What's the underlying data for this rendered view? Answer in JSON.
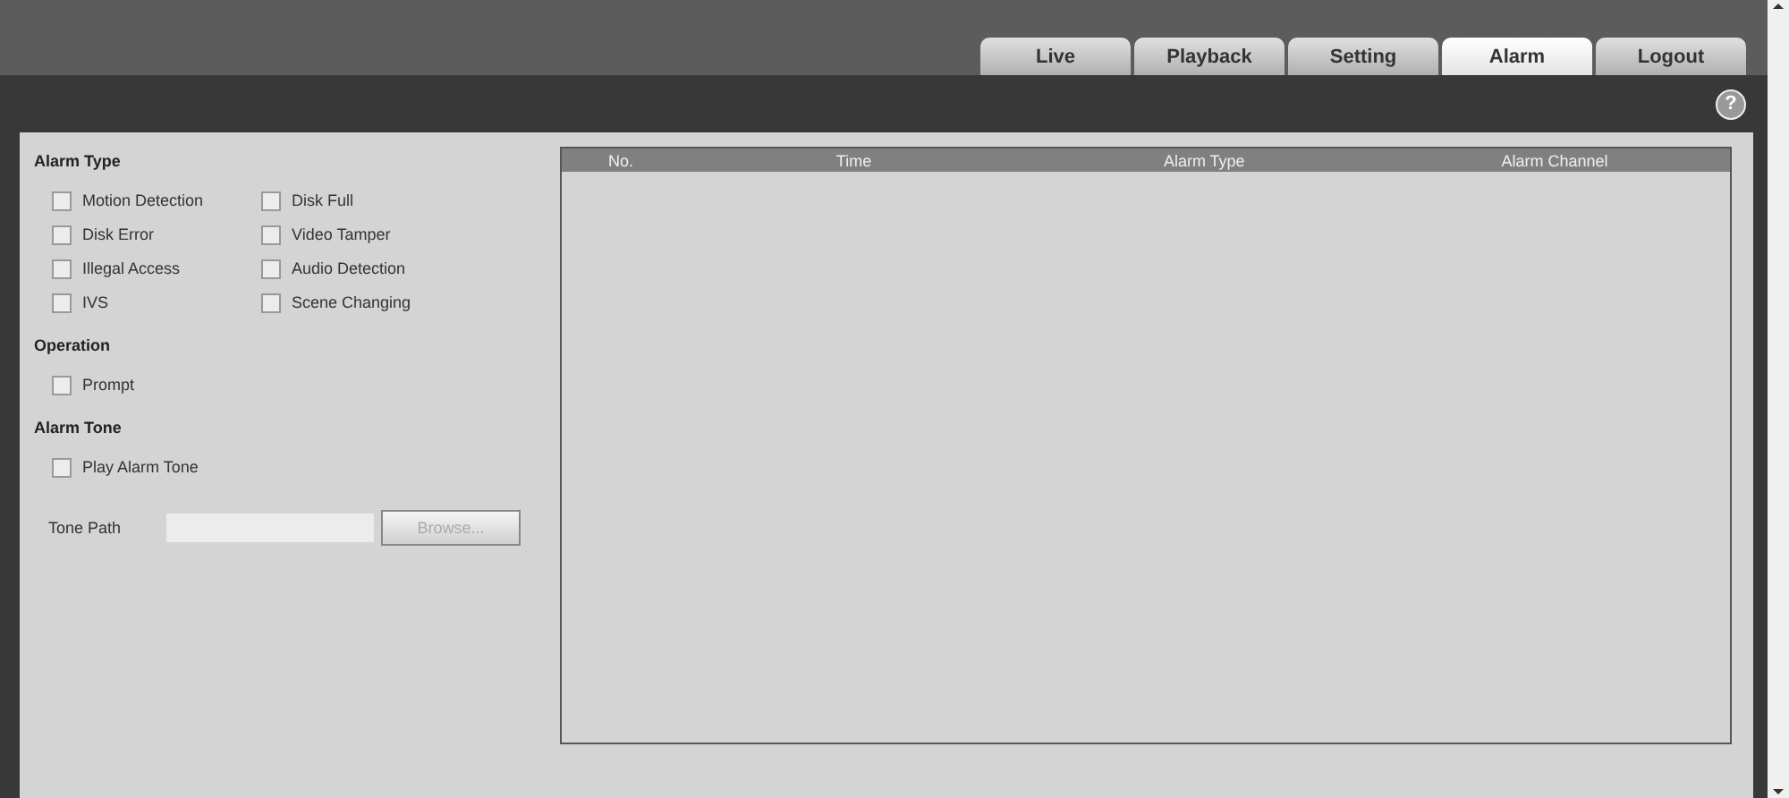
{
  "tabs": [
    {
      "label": "Live",
      "selected": false
    },
    {
      "label": "Playback",
      "selected": false
    },
    {
      "label": "Setting",
      "selected": false
    },
    {
      "label": "Alarm",
      "selected": true
    },
    {
      "label": "Logout",
      "selected": false
    }
  ],
  "help": {
    "label": "?"
  },
  "sections": [
    {
      "title": "Alarm Type",
      "options": [
        {
          "label": "Motion Detection",
          "checked": false
        },
        {
          "label": "Disk Full",
          "checked": false
        },
        {
          "label": "Disk Error",
          "checked": false
        },
        {
          "label": "Video Tamper",
          "checked": false
        },
        {
          "label": "Illegal Access",
          "checked": false
        },
        {
          "label": "Audio Detection",
          "checked": false
        },
        {
          "label": "IVS",
          "checked": false
        },
        {
          "label": "Scene Changing",
          "checked": false
        }
      ]
    },
    {
      "title": "Operation",
      "options": [
        {
          "label": "Prompt",
          "checked": false
        }
      ]
    },
    {
      "title": "Alarm Tone",
      "options": [
        {
          "label": "Play Alarm Tone",
          "checked": false
        }
      ]
    }
  ],
  "tone_path": {
    "label": "Tone Path",
    "button": "Browse...",
    "disabled": true
  },
  "table": {
    "columns": [
      "No.",
      "Time",
      "Alarm Type",
      "Alarm Channel"
    ]
  }
}
